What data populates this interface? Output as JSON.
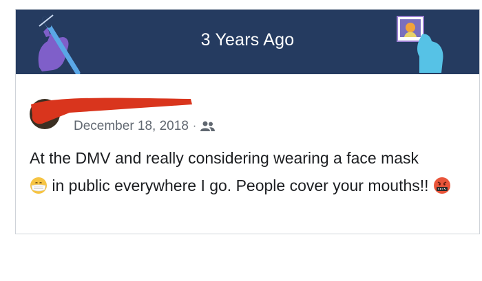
{
  "memory": {
    "title": "3 Years Ago"
  },
  "post": {
    "date": "December 18, 2018",
    "separator": "·",
    "audience_icon": "friends-icon",
    "text_part1": "At the DMV and really considering wearing a face mask",
    "text_part2": " in public everywhere I go. People cover your mouths!! ",
    "emoji_mask": "face-with-medical-mask",
    "emoji_angry": "face-with-symbols-on-mouth"
  },
  "colors": {
    "banner": "#253b60",
    "redaction": "#d9351d"
  }
}
